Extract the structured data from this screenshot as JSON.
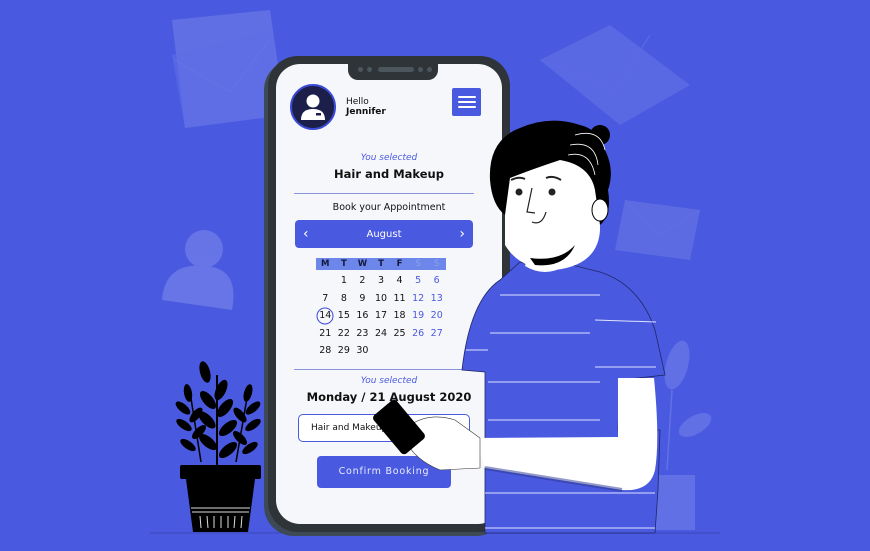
{
  "header": {
    "greeting": "Hello",
    "user_name": "Jennifer",
    "menu_icon": "hamburger-menu-icon",
    "avatar_icon": "user-avatar-icon"
  },
  "service": {
    "selected_label": "You selected",
    "name": "Hair and Makeup"
  },
  "booking": {
    "title": "Book your Appointment",
    "month": "August",
    "prev_icon": "chevron-left-icon",
    "next_icon": "chevron-right-icon",
    "weekdays": [
      "M",
      "T",
      "W",
      "T",
      "F",
      "S",
      "S"
    ],
    "weeks": [
      [
        "",
        "1",
        "2",
        "3",
        "4",
        "5",
        "6"
      ],
      [
        "7",
        "8",
        "9",
        "10",
        "11",
        "12",
        "13"
      ],
      [
        "14",
        "15",
        "16",
        "17",
        "18",
        "19",
        "20"
      ],
      [
        "21",
        "22",
        "23",
        "24",
        "25",
        "26",
        "27"
      ],
      [
        "28",
        "29",
        "30",
        "",
        "",
        "",
        ""
      ]
    ],
    "highlighted_day": "14"
  },
  "selection": {
    "selected_label": "You selected",
    "date": "Monday / 21 August 2020",
    "service_field_value": "Hair and Makeup"
  },
  "actions": {
    "confirm_label": "Confirm Booking"
  },
  "colors": {
    "background": "#4a5ae0",
    "accent": "#4a5ae0",
    "phone_frame": "#2e3438",
    "screen": "#f6f7fa"
  }
}
